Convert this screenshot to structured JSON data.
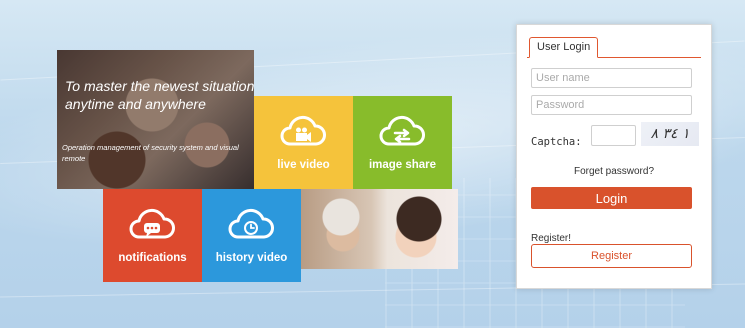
{
  "banner": {
    "title": "To  master the newest situation anytime and anywhere",
    "subtitle": "Operation management of security system and visual remote"
  },
  "tiles": {
    "live_video": {
      "label": "live video",
      "icon": "video-camera-cloud-icon",
      "color": "#f5c33b"
    },
    "image_share": {
      "label": "image share",
      "icon": "share-arrows-cloud-icon",
      "color": "#88bc2b"
    },
    "notifications": {
      "label": "notifications",
      "icon": "chat-bubble-cloud-icon",
      "color": "#dd4a2e"
    },
    "history_video": {
      "label": "history video",
      "icon": "clock-cloud-icon",
      "color": "#2c98dc"
    }
  },
  "login": {
    "tab_label": "User Login",
    "username_placeholder": "User name",
    "password_placeholder": "Password",
    "captcha_label": "Captcha:",
    "captcha_text": "١ ٣٤ ٨",
    "forget_password": "Forget password?",
    "login_button": "Login",
    "register_label": "Register!",
    "register_button": "Register",
    "accent_color": "#d9522c"
  }
}
